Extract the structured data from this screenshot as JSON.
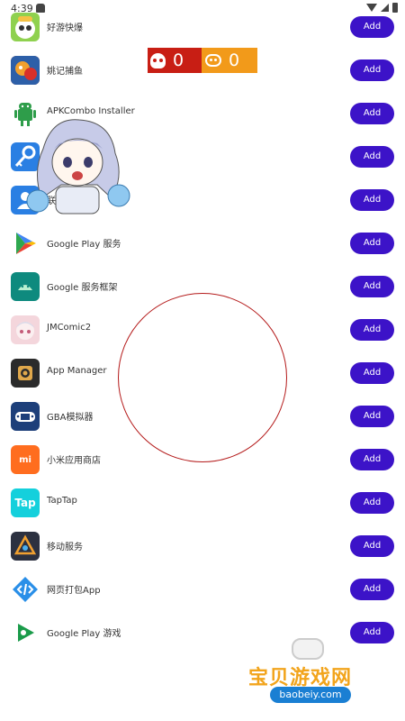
{
  "status_bar": {
    "time": "4:39"
  },
  "score_panel": {
    "skull_score": "0",
    "robot_score": "0"
  },
  "apps": [
    {
      "name": "好游快爆",
      "icon": "hykb-icon",
      "color": "#8fd14f",
      "button": "Add"
    },
    {
      "name": "姚记捕鱼",
      "icon": "fishing-game-icon",
      "color": "#e0542a",
      "button": "Add"
    },
    {
      "name": "APKCombo Installer",
      "icon": "android-robot-icon",
      "color": "#ffffff",
      "button": "Add"
    },
    {
      "name": "",
      "icon": "key-icon",
      "color": "#2a7fe3",
      "button": "Add"
    },
    {
      "name": "联系人存储",
      "icon": "contacts-icon",
      "color": "#2a7fe3",
      "button": "Add"
    },
    {
      "name": "Google Play 服务",
      "icon": "google-play-services-icon",
      "color": "#ffffff",
      "button": "Add"
    },
    {
      "name": "Google 服务框架",
      "icon": "android-framework-icon",
      "color": "#0e8a7e",
      "button": "Add"
    },
    {
      "name": "JMComic2",
      "icon": "jmcomic-icon",
      "color": "#f4d6dc",
      "button": "Add"
    },
    {
      "name": "App Manager",
      "icon": "gear-icon",
      "color": "#2b2b2b",
      "button": "Add"
    },
    {
      "name": "GBA模拟器",
      "icon": "gba-emulator-icon",
      "color": "#1d3f7a",
      "button": "Add"
    },
    {
      "name": "小米应用商店",
      "icon": "xiaomi-store-icon",
      "color": "#ff6d1f",
      "button": "Add"
    },
    {
      "name": "TapTap",
      "icon": "taptap-icon",
      "color": "#14d0dc",
      "button": "Add"
    },
    {
      "name": "移动服务",
      "icon": "mobile-service-icon",
      "color": "#2c3140",
      "button": "Add"
    },
    {
      "name": "网页打包App",
      "icon": "code-bracket-icon",
      "color": "#ffffff",
      "button": "Add"
    },
    {
      "name": "Google Play 游戏",
      "icon": "google-play-games-icon",
      "color": "#ffffff",
      "button": "Add"
    }
  ],
  "watermark": {
    "title": "宝贝游戏网",
    "url": "baobeiy.com"
  },
  "icon_texts": {
    "taptap": "Tap",
    "xiaomi": "mi"
  },
  "accent_color": "#3c13c8"
}
